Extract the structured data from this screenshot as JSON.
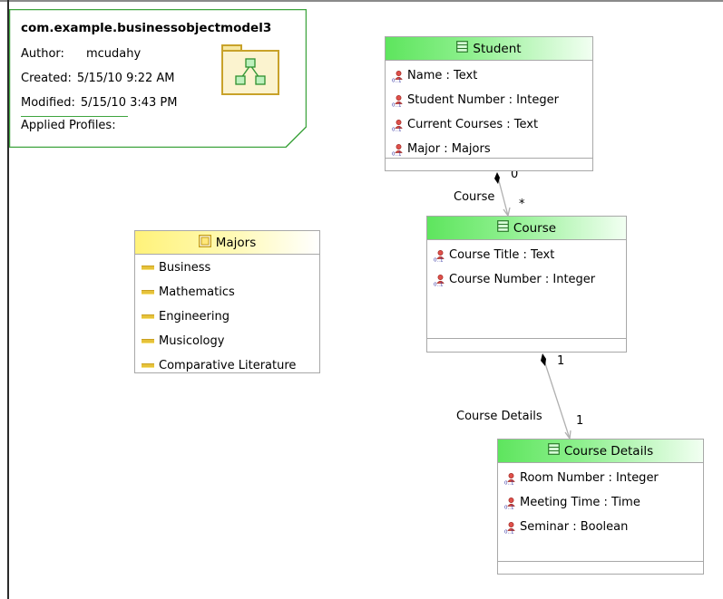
{
  "model": {
    "title": "com.example.businessobjectmodel3",
    "author_label": "Author:",
    "author": "mcudahy",
    "created_label": "Created:",
    "created": "5/15/10 9:22 AM",
    "modified_label": "Modified:",
    "modified": "5/15/10 3:43 PM",
    "profiles_label": "Applied Profiles:",
    "icon": "package-diagram-icon"
  },
  "classes": {
    "student": {
      "name": "Student",
      "icon": "class-icon",
      "attributes": [
        "Name : Text",
        "Student Number : Integer",
        "Current Courses : Text",
        "Major : Majors"
      ]
    },
    "course": {
      "name": "Course",
      "icon": "class-icon",
      "attributes": [
        "Course Title : Text",
        "Course Number : Integer"
      ]
    },
    "course_details": {
      "name": "Course Details",
      "icon": "class-icon",
      "attributes": [
        "Room Number : Integer",
        "Meeting Time : Time",
        "Seminar : Boolean"
      ]
    }
  },
  "enums": {
    "majors": {
      "name": "Majors",
      "icon": "enumeration-icon",
      "literals": [
        "Business",
        "Mathematics",
        "Engineering",
        "Musicology",
        "Comparative Literature"
      ]
    }
  },
  "relations": {
    "student_course": {
      "label": "Course",
      "source_multiplicity": "0",
      "target_multiplicity": "*"
    },
    "course_details": {
      "label": "Course Details",
      "source_multiplicity": "1",
      "target_multiplicity": "1"
    }
  },
  "colors": {
    "class_header": "#5ee55e",
    "enum_header": "#fff27a",
    "note_border": "#3fa43f",
    "box_border": "#a8a8a8"
  }
}
